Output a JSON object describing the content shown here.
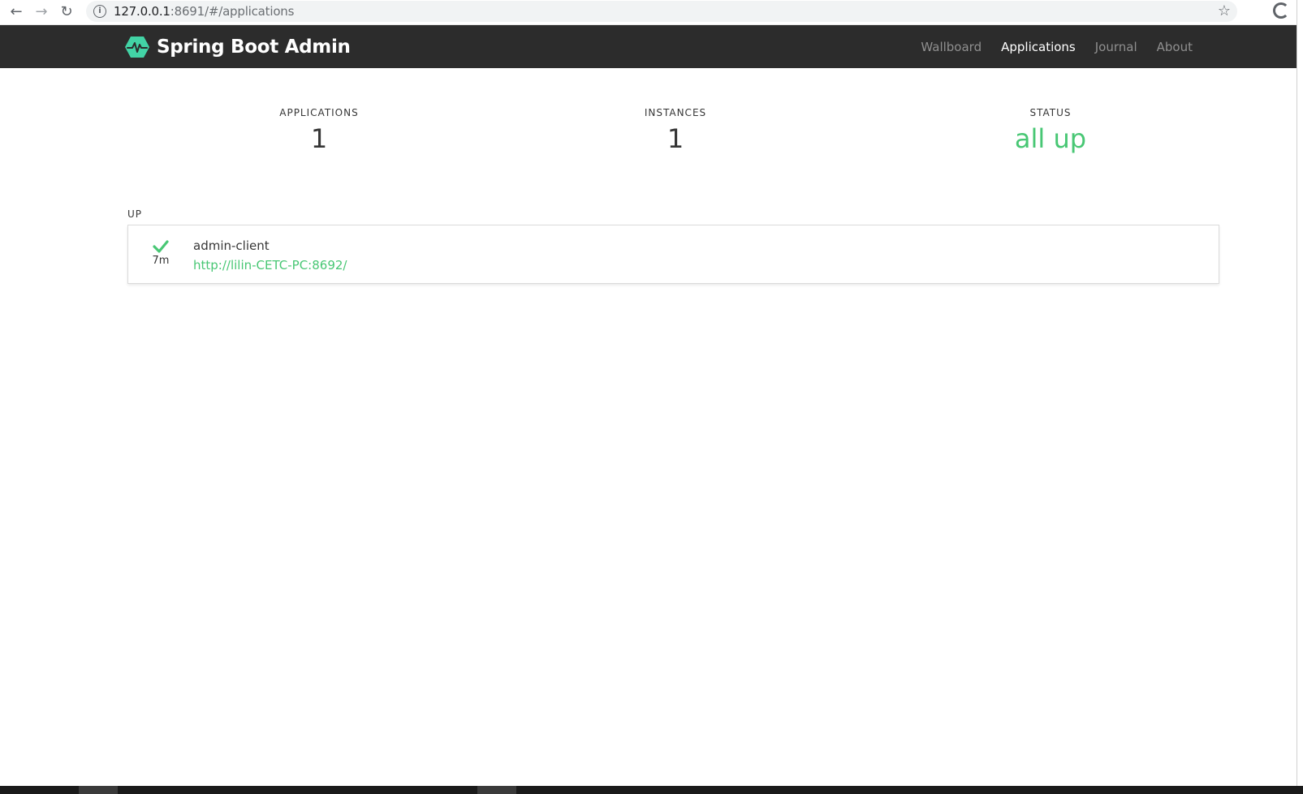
{
  "browser": {
    "url_host": "127.0.0.1",
    "url_rest": ":8691/#/applications",
    "icons": [
      "back-icon",
      "forward-icon",
      "reload-icon",
      "info-icon",
      "star-icon",
      "extension-icon"
    ]
  },
  "navbar": {
    "brand": "Spring Boot Admin",
    "links": [
      {
        "label": "Wallboard",
        "active": false
      },
      {
        "label": "Applications",
        "active": true
      },
      {
        "label": "Journal",
        "active": false
      },
      {
        "label": "About",
        "active": false
      }
    ]
  },
  "summary": {
    "applications_label": "APPLICATIONS",
    "applications_value": "1",
    "instances_label": "INSTANCES",
    "instances_value": "1",
    "status_label": "STATUS",
    "status_value": "all up"
  },
  "groups": [
    {
      "label": "UP",
      "apps": [
        {
          "name": "admin-client",
          "url": "http://lilin-CETC-PC:8692/",
          "uptime": "7m",
          "status_icon": "check-icon"
        }
      ]
    }
  ],
  "colors": {
    "navbar_bg": "#2c2c2c",
    "accent_green": "#48c774",
    "text_dark": "#363636"
  }
}
